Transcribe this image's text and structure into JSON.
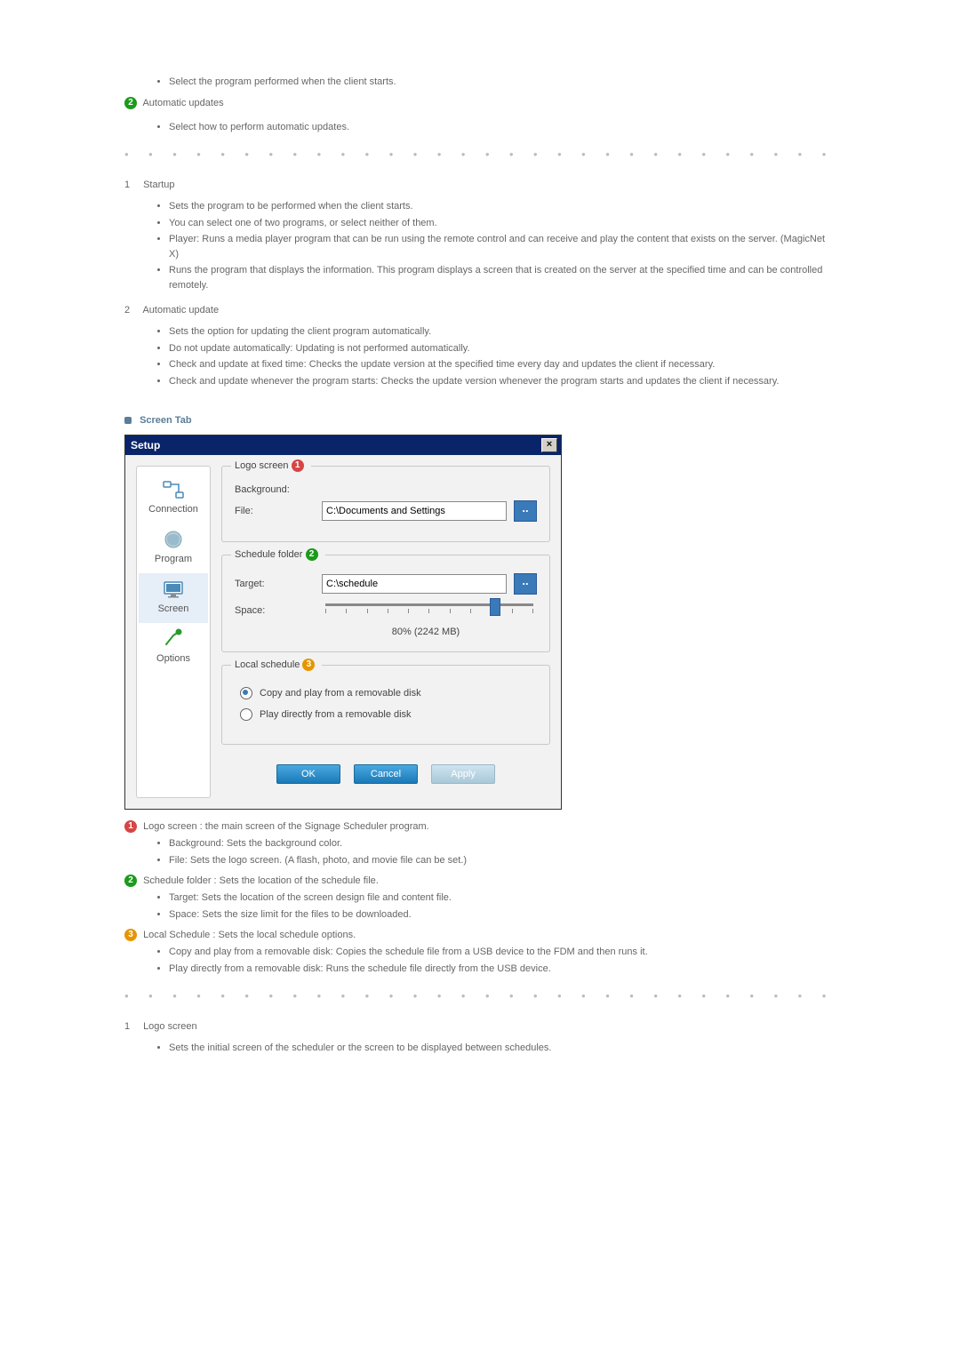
{
  "intro": {
    "bullet1": "Select the program performed when the client starts.",
    "auto_updates_label": "Automatic updates",
    "bullet2": "Select how to perform automatic updates."
  },
  "section1": {
    "num": "1",
    "title": "Startup",
    "b1": "Sets the program to be performed when the client starts.",
    "b2": "You can select one of two programs, or select neither of them.",
    "b3": "Player: Runs a media player program that can be run using the remote control and can receive and play the content that exists on the server. (MagicNet X)",
    "b4": "Runs the program that displays the information. This program displays a screen that is created on the server at the specified time and can be controlled remotely."
  },
  "section2": {
    "num": "2",
    "title": "Automatic update",
    "b1": "Sets the option for updating the client program automatically.",
    "b2": "Do not update automatically: Updating is not performed automatically.",
    "b3": "Check and update at fixed time: Checks the update version at the specified time every day and updates the client if necessary.",
    "b4": "Check and update whenever the program starts: Checks the update version whenever the program starts and updates the client if necessary."
  },
  "screen_tab_label": "Screen Tab",
  "dialog": {
    "title": "Setup",
    "close": "×",
    "sidebar": {
      "connection": "Connection",
      "program": "Program",
      "screen": "Screen",
      "options": "Options"
    },
    "group1": {
      "legend": "Logo screen",
      "background_label": "Background:",
      "file_label": "File:",
      "file_value": "C:\\Documents and Settings",
      "browse": ".."
    },
    "group2": {
      "legend": "Schedule folder",
      "target_label": "Target:",
      "target_value": "C:\\schedule",
      "browse": "..",
      "space_label": "Space:",
      "space_value": "80% (2242 MB)",
      "slider_percent": 80
    },
    "group3": {
      "legend": "Local schedule",
      "opt1": "Copy and play from a removable disk",
      "opt2": "Play directly from a removable disk"
    },
    "buttons": {
      "ok": "OK",
      "cancel": "Cancel",
      "apply": "Apply"
    }
  },
  "desc1": {
    "title": "Logo screen : the main screen of the Signage Scheduler program.",
    "b1": "Background: Sets the background color.",
    "b2": "File: Sets the logo screen. (A flash, photo, and movie file can be set.)"
  },
  "desc2": {
    "title": "Schedule folder : Sets the location of the schedule file.",
    "b1": "Target: Sets the location of the screen design file and content file.",
    "b2": "Space: Sets the size limit for the files to be downloaded."
  },
  "desc3": {
    "title": "Local Schedule : Sets the local schedule options.",
    "b1": "Copy and play from a removable disk: Copies the schedule file from a USB device to the FDM and then runs it.",
    "b2": "Play directly from a removable disk: Runs the schedule file directly from the USB device."
  },
  "section3": {
    "num": "1",
    "title": "Logo screen",
    "b1": "Sets the initial screen of the scheduler or the screen to be displayed between schedules."
  }
}
